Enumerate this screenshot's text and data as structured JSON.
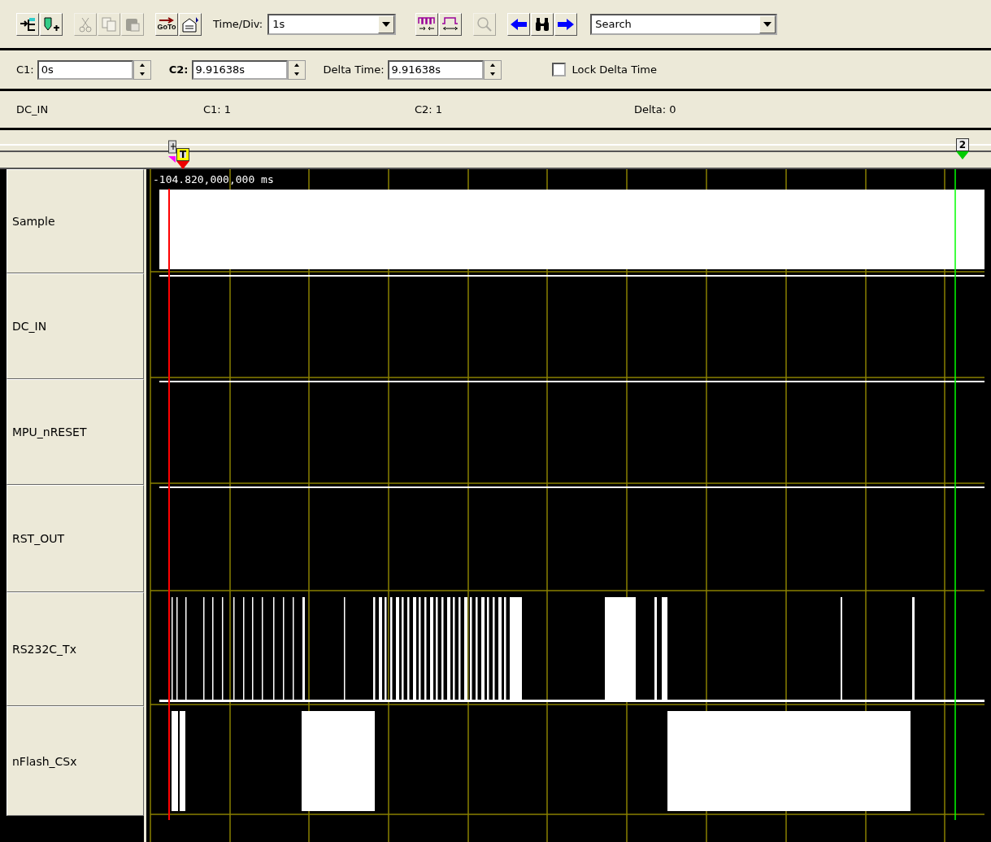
{
  "toolbar": {
    "left_buttons": [
      {
        "disabled": false
      },
      {
        "disabled": false
      },
      {
        "disabled": true
      },
      {
        "disabled": true
      },
      {
        "disabled": true
      },
      {
        "label": "GoTo",
        "disabled": false
      },
      {
        "disabled": false
      }
    ],
    "time_div": {
      "label": "Time/Div:",
      "value": "1s"
    },
    "right_buttons": [
      {
        "disabled": false
      },
      {
        "disabled": false
      },
      {
        "disabled": true
      },
      {
        "disabled": false
      },
      {
        "disabled": false
      },
      {
        "disabled": false
      }
    ],
    "search": {
      "value": "Search"
    }
  },
  "cursors": {
    "c1": {
      "label": "C1:",
      "value": "0s"
    },
    "c2": {
      "label": "C2:",
      "value": "9.91638s"
    },
    "delta": {
      "label": "Delta Time:",
      "value": "9.91638s"
    },
    "lock": {
      "label": "Lock Delta Time",
      "checked": false
    }
  },
  "info": {
    "signal": "DC_IN",
    "c1": "C1: 1",
    "c2": "C2: 1",
    "delta": "Delta: 0"
  },
  "markers": [
    {
      "kind": "trigger",
      "label": "T"
    },
    {
      "kind": "cursor",
      "label": "2"
    }
  ],
  "plot": {
    "time_label": "-104.820,000,000 ms",
    "signals": [
      {
        "name": "Sample"
      },
      {
        "name": "DC_IN"
      },
      {
        "name": "MPU_nRESET"
      },
      {
        "name": "RST_OUT"
      },
      {
        "name": "RS232C_Tx"
      },
      {
        "name": "nFlash_CSx"
      }
    ]
  }
}
